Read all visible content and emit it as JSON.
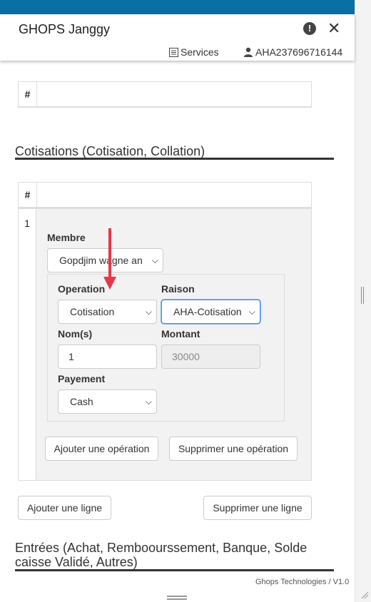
{
  "header": {
    "title": "GHOPS Janggy",
    "info_icon": "!",
    "close_icon": "✕",
    "services_label": "Services",
    "account_id": "AHA237696716144"
  },
  "first_table": {
    "hash_header": "#"
  },
  "cotisations": {
    "title": "Cotisations (Cotisation, Collation)",
    "hash_header": "#",
    "row_number": "1",
    "membre_label": "Membre",
    "membre_value": "Gopdjim wagne an",
    "operation_label": "Operation",
    "operation_value": "Cotisation",
    "raison_label": "Raison",
    "raison_value": "AHA-Cotisation",
    "noms_label": "Nom(s)",
    "noms_value": "1",
    "montant_label": "Montant",
    "montant_value": "30000",
    "payement_label": "Payement",
    "payement_value": "Cash",
    "add_operation": "Ajouter une opération",
    "remove_operation": "Supprimer une opération",
    "add_line": "Ajouter une ligne",
    "remove_line": "Supprimer une ligne"
  },
  "entrees": {
    "title_line1": "Entrées (Achat, Remboourssement, Banque, Solde",
    "title_line2": "caisse Validé, Autres)"
  },
  "footer": {
    "credit": "Ghops Technologies / V1.0"
  },
  "colors": {
    "topbar": "#0a6fa3",
    "arrow": "#e8364a",
    "focus": "#4a90e2"
  }
}
